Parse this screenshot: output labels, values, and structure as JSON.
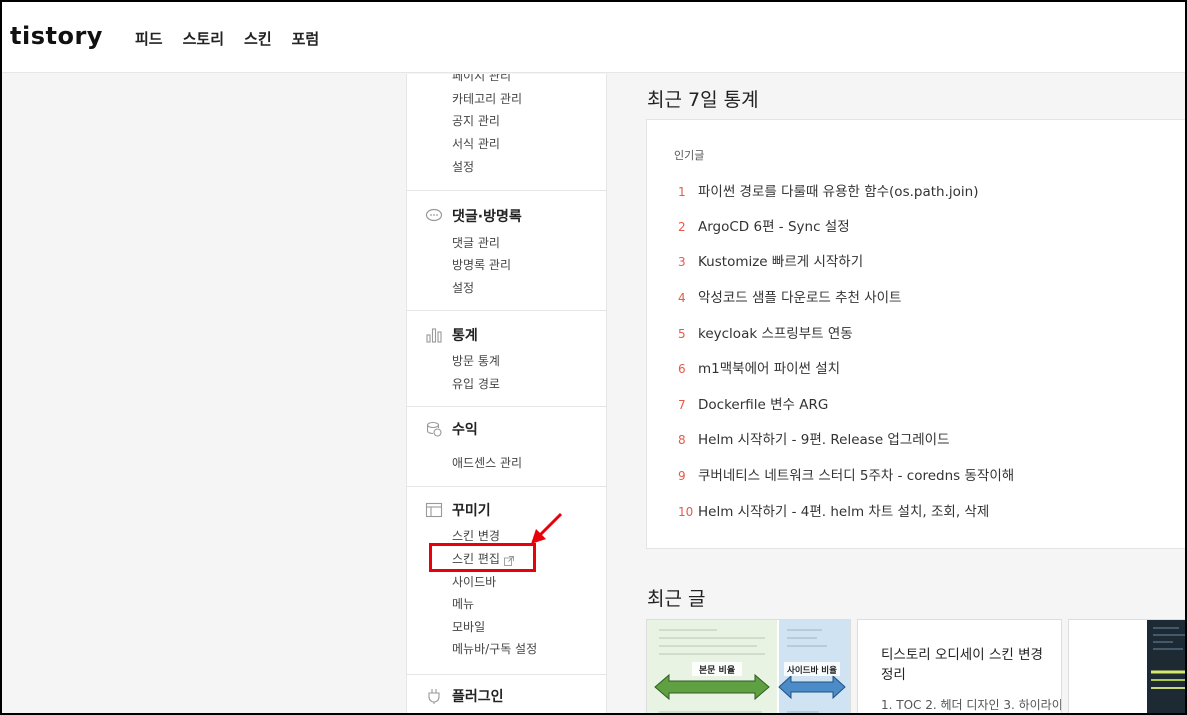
{
  "header": {
    "logo": "tistory",
    "nav": [
      "피드",
      "스토리",
      "스킨",
      "포럼"
    ]
  },
  "sidebar": {
    "top_items": [
      "페이지 관리",
      "카테고리 관리",
      "공지 관리",
      "서식 관리",
      "설정"
    ],
    "sections": [
      {
        "title": "댓글·방명록",
        "icon": "comment-icon",
        "items": [
          "댓글 관리",
          "방명록 관리",
          "설정"
        ]
      },
      {
        "title": "통계",
        "icon": "chart-icon",
        "items": [
          "방문 통계",
          "유입 경로"
        ]
      },
      {
        "title": "수익",
        "icon": "coins-icon",
        "items": [
          "애드센스 관리"
        ]
      },
      {
        "title": "꾸미기",
        "icon": "layout-icon",
        "items": [
          "스킨 변경",
          "스킨 편집",
          "사이드바",
          "메뉴",
          "모바일",
          "메뉴바/구독 설정"
        ]
      },
      {
        "title": "플러그인",
        "icon": "plug-icon",
        "items": []
      }
    ]
  },
  "main": {
    "stats_title": "최근 7일 통계",
    "popular_label": "인기글",
    "popular": [
      {
        "rank": "1",
        "title": "파이썬 경로를 다룰때 유용한 함수(os.path.join)"
      },
      {
        "rank": "2",
        "title": "ArgoCD 6편 - Sync 설정"
      },
      {
        "rank": "3",
        "title": "Kustomize 빠르게 시작하기"
      },
      {
        "rank": "4",
        "title": "악성코드 샘플 다운로드 추천 사이트"
      },
      {
        "rank": "5",
        "title": "keycloak 스프링부트 연동"
      },
      {
        "rank": "6",
        "title": "m1맥북에어 파이썬 설치"
      },
      {
        "rank": "7",
        "title": "Dockerfile 변수 ARG"
      },
      {
        "rank": "8",
        "title": "Helm 시작하기 - 9편. Release 업그레이드"
      },
      {
        "rank": "9",
        "title": "쿠버네티스 네트워크 스터디 5주차 - coredns 동작이해"
      },
      {
        "rank": "10",
        "title": "Helm 시작하기 - 4편. helm 차트 설치, 조회, 삭제"
      }
    ],
    "recent_title": "최근 글",
    "recent_posts": [
      {
        "labels": [
          "본문 비율",
          "사이드바 비율"
        ]
      },
      {
        "title": "티스토리 오디세이 스킨 변경 정리",
        "excerpt": "1. TOC 2. 헤더 디자인 3. 하이라이"
      },
      {}
    ]
  },
  "colors": {
    "accent_red": "#e8594a",
    "annotation": "#e8000b"
  }
}
